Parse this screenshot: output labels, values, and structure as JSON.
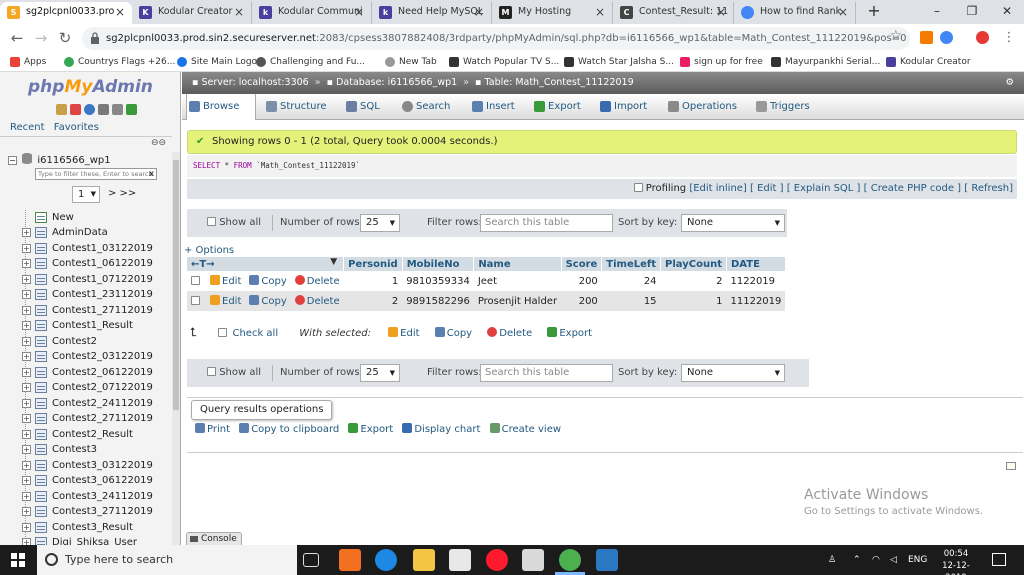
{
  "browser": {
    "tabs": [
      {
        "label": "sg2plcpnl0033.pro",
        "favicon": "cpanel-icon",
        "color": "#f5a623",
        "active": true
      },
      {
        "label": "Kodular Creator",
        "favicon": "kodular-icon",
        "color": "#4a3f9f"
      },
      {
        "label": "Kodular Communi",
        "favicon": "kodular-icon",
        "color": "#4a3f9f"
      },
      {
        "label": "Need Help MySQL",
        "favicon": "kodular-icon",
        "color": "#4a3f9f"
      },
      {
        "label": "My Hosting",
        "favicon": "godaddy-icon",
        "color": "#222222"
      },
      {
        "label": "Contest_Result: 11",
        "favicon": "cpanel-icon",
        "color": "#444444"
      },
      {
        "label": "How to find Rank",
        "favicon": "google-icon",
        "color": "#4285f4"
      }
    ],
    "url_host": "sg2plcpnl0033.prod.sin2.secureserver.net",
    "url_rest": ":2083/cpsess3807882408/3rdparty/phpMyAdmin/sql.php?db=i6116566_wp1&table=Math_Contest_11122019&pos=0",
    "bookmarks": [
      {
        "label": "Apps",
        "color": "#ea4335"
      },
      {
        "label": "Countrys Flags +26...",
        "color": "#34a853"
      },
      {
        "label": "Site Main Logo",
        "color": "#1a73e8"
      },
      {
        "label": "Challenging and Fu...",
        "color": "#555555"
      },
      {
        "label": "New Tab",
        "color": "#999999"
      },
      {
        "label": "Watch Popular TV S...",
        "color": "#333333"
      },
      {
        "label": "Watch Star Jalsha S...",
        "color": "#333333"
      },
      {
        "label": "sign up for free",
        "color": "#e91e63"
      },
      {
        "label": "Mayurpankhi Serial...",
        "color": "#333333"
      },
      {
        "label": "Kodular Creator",
        "color": "#4a3f9f"
      }
    ]
  },
  "nav": {
    "logo_php": "php",
    "logo_my": "My",
    "logo_admin": "Admin",
    "recent": "Recent",
    "favorites": "Favorites",
    "db_name": "i6116566_wp1",
    "filter_placeholder": "Type to filter these, Enter to search",
    "filter_clear": "X",
    "page": "1",
    "next": "> >>",
    "new_label": "New",
    "tables": [
      "AdminData",
      "Contest1_03122019",
      "Contest1_06122019",
      "Contest1_07122019",
      "Contest1_23112019",
      "Contest1_27112019",
      "Contest1_Result",
      "Contest2",
      "Contest2_03122019",
      "Contest2_06122019",
      "Contest2_07122019",
      "Contest2_24112019",
      "Contest2_27112019",
      "Contest2_Result",
      "Contest3",
      "Contest3_03122019",
      "Contest3_06122019",
      "Contest3_24112019",
      "Contest3_27112019",
      "Contest3_Result",
      "Digi_Shiksa_User"
    ]
  },
  "breadcrumb": {
    "server": "Server: localhost:3306",
    "database": "Database: i6116566_wp1",
    "table": "Table: Math_Contest_11122019"
  },
  "menu": [
    "Browse",
    "Structure",
    "SQL",
    "Search",
    "Insert",
    "Export",
    "Import",
    "Operations",
    "Triggers"
  ],
  "result": {
    "success": "Showing rows 0 - 1 (2 total, Query took 0.0004 seconds.)",
    "sql_kw1": "SELECT",
    "sql_mid": " * ",
    "sql_kw2": "FROM",
    "sql_table": " `Math_Contest_11122019`",
    "profiling": "Profiling",
    "links": "[Edit inline] [ Edit ] [ Explain SQL ] [ Create PHP code ] [ Refresh]"
  },
  "navbar": {
    "show_all": "Show all",
    "num_rows_label": "Number of rows:",
    "num_rows": "25",
    "filter_label": "Filter rows:",
    "filter_placeholder": "Search this table",
    "sort_label": "Sort by key:",
    "sort_value": "None"
  },
  "table": {
    "options": "+ Options",
    "columns": [
      "Personid",
      "MobileNo",
      "Name",
      "Score",
      "TimeLeft",
      "PlayCount",
      "DATE"
    ],
    "actions": {
      "edit": "Edit",
      "copy": "Copy",
      "delete": "Delete"
    },
    "rows": [
      [
        "1",
        "9810359334",
        "Jeet",
        "200",
        "24",
        "2",
        "1122019"
      ],
      [
        "2",
        "9891582296",
        "Prosenjit Halder",
        "200",
        "15",
        "1",
        "11122019"
      ]
    ]
  },
  "with_selected": {
    "check_all": "Check all",
    "label": "With selected:",
    "edit": "Edit",
    "copy": "Copy",
    "delete": "Delete",
    "export": "Export"
  },
  "qro": {
    "title": "Query results operations",
    "print": "Print",
    "copy": "Copy to clipboard",
    "export": "Export",
    "chart": "Display chart",
    "view": "Create view"
  },
  "console": "Console",
  "watermark": {
    "line1": "Activate Windows",
    "line2": "Go to Settings to activate Windows."
  },
  "taskbar": {
    "search": "Type here to search",
    "lang": "ENG",
    "time": "00:54",
    "date": "12-12-2019"
  }
}
